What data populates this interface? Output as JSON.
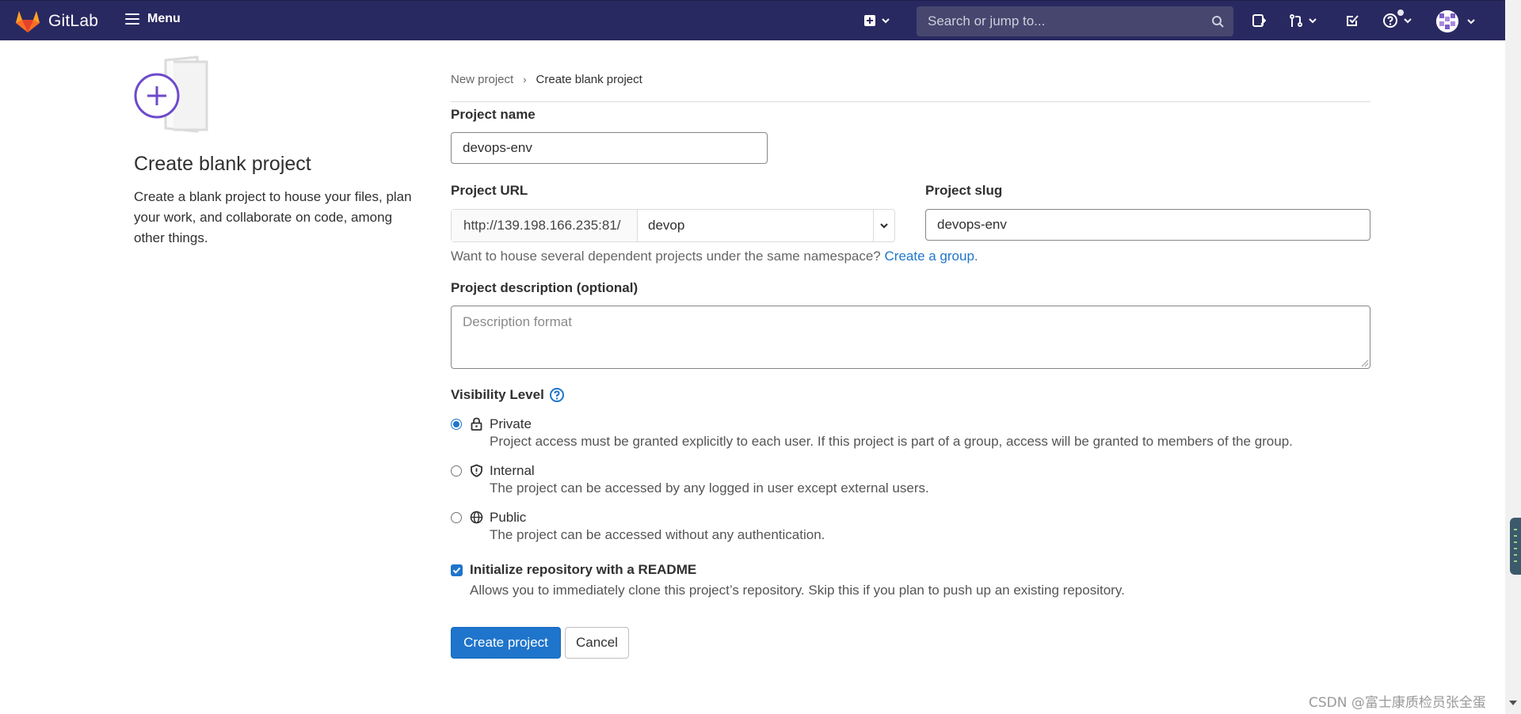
{
  "header": {
    "brand": "GitLab",
    "menu_label": "Menu",
    "search_placeholder": "Search or jump to...",
    "icons": [
      "gitlab-logo",
      "hamburger-icon",
      "plus-square-icon",
      "search-icon",
      "issues-icon",
      "merge-request-icon",
      "todo-check-icon",
      "help-icon",
      "user-avatar"
    ]
  },
  "left": {
    "title": "Create blank project",
    "description": "Create a blank project to house your files, plan your work, and collaborate on code, among other things."
  },
  "breadcrumb": {
    "parent": "New project",
    "separator": "›",
    "current": "Create blank project"
  },
  "form": {
    "project_name_label": "Project name",
    "project_name_value": "devops-env",
    "project_url_label": "Project URL",
    "url_prefix": "http://139.198.166.235:81/",
    "namespace_value": "devop",
    "project_slug_label": "Project slug",
    "project_slug_value": "devops-env",
    "help_prefix": "Want to house several dependent projects under the same namespace?",
    "help_link": "Create a group",
    "help_suffix": ".",
    "description_label": "Project description (optional)",
    "description_placeholder": "Description format",
    "visibility_label": "Visibility Level",
    "visibility_options": [
      {
        "title": "Private",
        "description": "Project access must be granted explicitly to each user. If this project is part of a group, access will be granted to members of the group.",
        "selected": true,
        "icon": "lock-icon"
      },
      {
        "title": "Internal",
        "description": "The project can be accessed by any logged in user except external users.",
        "selected": false,
        "icon": "shield-icon"
      },
      {
        "title": "Public",
        "description": "The project can be accessed without any authentication.",
        "selected": false,
        "icon": "globe-icon"
      }
    ],
    "readme_title": "Initialize repository with a README",
    "readme_description": "Allows you to immediately clone this project’s repository. Skip this if you plan to push up an existing repository.",
    "readme_checked": true,
    "create_button": "Create project",
    "cancel_button": "Cancel"
  },
  "watermark": "CSDN @富士康质检员张全蛋",
  "colors": {
    "navbar": "#292961",
    "primary": "#1f75cb",
    "link": "#1f75cb",
    "illustration_accent": "#6e49cb"
  }
}
